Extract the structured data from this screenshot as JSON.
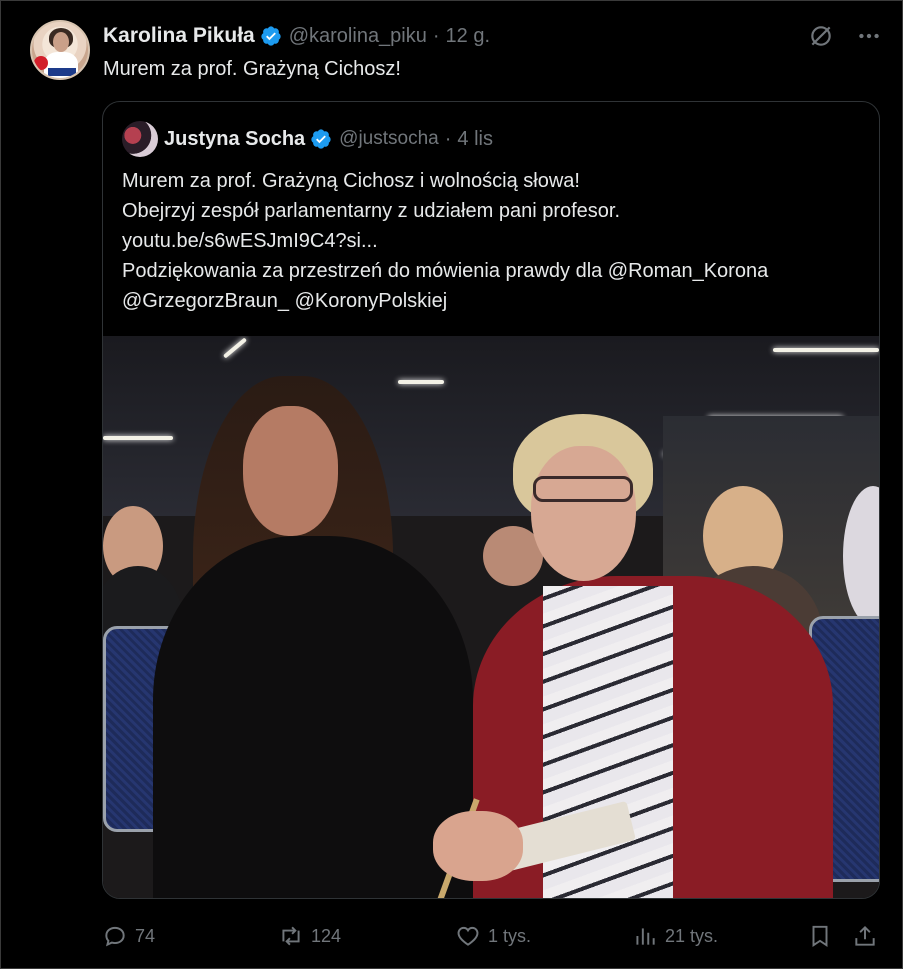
{
  "tweet": {
    "author_name": "Karolina Pikuła",
    "author_handle": "@karolina_piku",
    "separator": "·",
    "time": "12 g.",
    "text": "Murem za prof. Grażyną Cichosz!"
  },
  "quote": {
    "author_name": "Justyna Socha",
    "author_handle": "@justsocha",
    "separator": "·",
    "time": "4 lis",
    "lines": [
      "Murem za prof. Grażyną Cichosz i wolnością słowa!",
      "Obejrzyj zespół parlamentarny z udziałem pani profesor.",
      "youtu.be/s6wESJmI9C4?si...",
      "Podziękowania za przestrzeń do mówienia prawdy dla @Roman_Korona",
      "@GrzegorzBraun_ @KoronyPolskiej"
    ]
  },
  "actions": {
    "replies": "74",
    "reposts": "124",
    "likes": "1 tys.",
    "views": "21 tys."
  },
  "colors": {
    "background": "#000000",
    "text": "#e7e9ea",
    "muted": "#71767b",
    "verified": "#1d9bf0",
    "border": "#2f3336"
  },
  "icons": [
    "verified-badge-icon",
    "grok-icon",
    "more-icon",
    "reply-icon",
    "repost-icon",
    "like-icon",
    "views-icon",
    "bookmark-icon",
    "share-icon"
  ]
}
